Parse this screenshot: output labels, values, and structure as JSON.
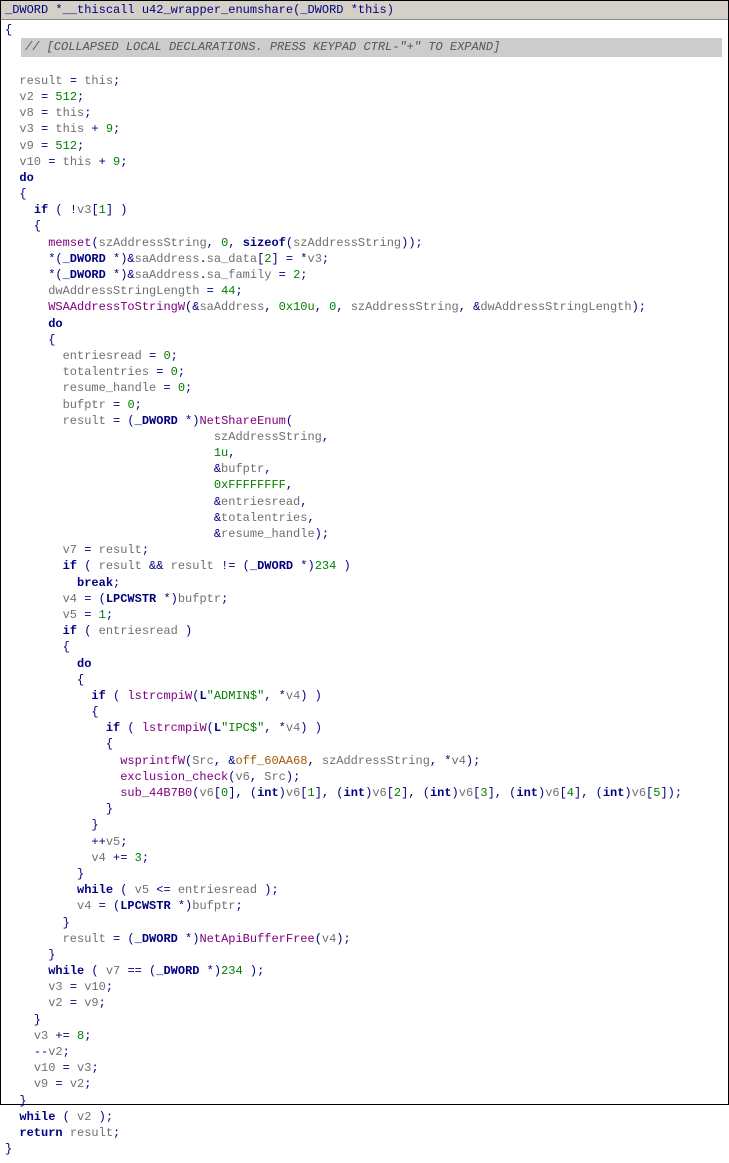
{
  "header": {
    "ret_type": "_DWORD",
    "ptr": "*",
    "callconv": "__thiscall",
    "func_name": "u42_wrapper_enumshare",
    "param_list": "(_DWORD *this)"
  },
  "collapsed_banner": "// [COLLAPSED LOCAL DECLARATIONS. PRESS KEYPAD CTRL-\"+\" TO EXPAND]",
  "code": {
    "v2_val": "512",
    "v3_off": "9",
    "v9_val": "512",
    "v10_off": "9",
    "memset_arg2": "0",
    "sa_idx": "2",
    "sa_family_val": "2",
    "dwlen_val": "44",
    "wsa_arg2": "0x10u",
    "wsa_arg3": "0",
    "zero": "0",
    "enum_level": "1u",
    "enum_max": "0xFFFFFFFF",
    "cast_234": "234",
    "v5_init": "1",
    "admin_str": "\"ADMIN$\"",
    "ipc_str": "\"IPC$\"",
    "v4_step": "3",
    "v3_step": "8",
    "off_name": "off_60AA68",
    "sub_name": "sub_44B7B0",
    "idx0": "0",
    "idx1": "1",
    "idx2": "2",
    "idx3": "3",
    "idx4": "4",
    "idx5": "5",
    "v3_idx": "1",
    "fn_memset": "memset",
    "fn_sizeof": "sizeof",
    "fn_wsa": "WSAAddressToStringW",
    "fn_netshare": "NetShareEnum",
    "fn_lstrcmpi": "lstrcmpiW",
    "fn_wsprintf": "wsprintfW",
    "fn_excl": "exclusion_check",
    "fn_netfree": "NetApiBufferFree",
    "var_result": "result",
    "var_this": "this",
    "var_v2": "v2",
    "var_v3": "v3",
    "var_v4": "v4",
    "var_v5": "v5",
    "var_v6": "v6",
    "var_v7": "v7",
    "var_v8": "v8",
    "var_v9": "v9",
    "var_v10": "v10",
    "var_szAddr": "szAddressString",
    "var_saAddr": "saAddress",
    "fld_sa_data": "sa_data",
    "fld_sa_family": "sa_family",
    "var_dwAddrLen": "dwAddressStringLength",
    "var_entries": "entriesread",
    "var_total": "totalentries",
    "var_resume": "resume_handle",
    "var_bufptr": "bufptr",
    "var_Src": "Src",
    "type_dword": "_DWORD",
    "type_lpcwstr": "LPCWSTR",
    "type_int": "int",
    "kw_if": "if",
    "kw_do": "do",
    "kw_while": "while",
    "kw_break": "break",
    "kw_return": "return",
    "kw_L": "L"
  }
}
